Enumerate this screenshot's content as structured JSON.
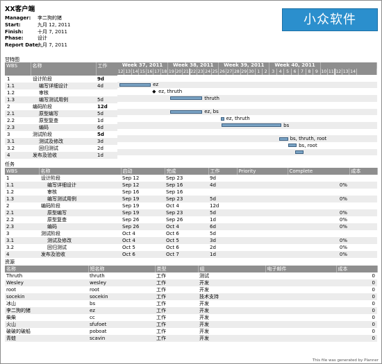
{
  "title": "XX客户端",
  "meta": [
    {
      "key": "Manager:",
      "value": "李二狗的猪"
    },
    {
      "key": "Start:",
      "value": "九月 12, 2011"
    },
    {
      "key": "Finish:",
      "value": "十月 7, 2011"
    },
    {
      "key": "Phase:",
      "value": "设计"
    },
    {
      "key": "Report Date:",
      "value": "九月 7, 2011"
    }
  ],
  "logo_text": "小众软件",
  "gantt": {
    "section_label": "甘特图",
    "headers": {
      "wbs": "WBS",
      "name": "名称",
      "work": "工作"
    },
    "weeks": [
      "Week 37, 2011",
      "Week 38, 2011",
      "Week 39, 2011",
      "Week 40, 2011"
    ],
    "days": [
      "12",
      "13",
      "14",
      "15",
      "16",
      "17",
      "18",
      "19",
      "20",
      "21",
      "22",
      "23",
      "24",
      "25",
      "26",
      "27",
      "28",
      "29",
      "30",
      "1",
      "2",
      "3",
      "4",
      "5",
      "6",
      "7",
      "8",
      "9",
      "10",
      "11",
      "12",
      "13",
      "14"
    ],
    "rows": [
      {
        "wbs": "1",
        "name": "设计阶段",
        "work": "9d",
        "bold": true,
        "label": ""
      },
      {
        "wbs": "1.1",
        "name": "编写详细设计",
        "work": "4d",
        "bold": false,
        "label": "ez"
      },
      {
        "wbs": "1.2",
        "name": "审核",
        "work": "",
        "bold": false,
        "label": "ez, thruth"
      },
      {
        "wbs": "1.3",
        "name": "编写测试用例",
        "work": "5d",
        "bold": false,
        "label": "thruth"
      },
      {
        "wbs": "2",
        "name": "编码阶段",
        "work": "12d",
        "bold": true,
        "label": ""
      },
      {
        "wbs": "2.1",
        "name": "原型编写",
        "work": "5d",
        "bold": false,
        "label": "ez, bs"
      },
      {
        "wbs": "2.2",
        "name": "原型复查",
        "work": "1d",
        "bold": false,
        "label": "ez, thruth"
      },
      {
        "wbs": "2.3",
        "name": "编码",
        "work": "6d",
        "bold": false,
        "label": "bs"
      },
      {
        "wbs": "3",
        "name": "测试阶段",
        "work": "5d",
        "bold": true,
        "label": ""
      },
      {
        "wbs": "3.1",
        "name": "测试及修改",
        "work": "3d",
        "bold": false,
        "label": "bs, thruth, root"
      },
      {
        "wbs": "3.2",
        "name": "回归测试",
        "work": "2d",
        "bold": false,
        "label": "bs, root"
      },
      {
        "wbs": "4",
        "name": "发布及验收",
        "work": "1d",
        "bold": false,
        "label": ""
      }
    ]
  },
  "tasks": {
    "section_label": "任务",
    "headers": [
      "WBS",
      "名称",
      "启动",
      "完成",
      "工作",
      "Priority",
      "Complete",
      "成本"
    ],
    "rows": [
      [
        "1",
        "设计阶段",
        "Sep 12",
        "Sep 23",
        "9d",
        "",
        "",
        ""
      ],
      [
        "1.1",
        "编写详细设计",
        "Sep 12",
        "Sep 16",
        "4d",
        "",
        "0%",
        ""
      ],
      [
        "1.2",
        "审核",
        "Sep 16",
        "Sep 16",
        "",
        "",
        "",
        ""
      ],
      [
        "1.3",
        "编写测试用例",
        "Sep 19",
        "Sep 23",
        "5d",
        "",
        "0%",
        ""
      ],
      [
        "2",
        "编码阶段",
        "Sep 19",
        "Oct 4",
        "12d",
        "",
        "",
        ""
      ],
      [
        "2.1",
        "原型编写",
        "Sep 19",
        "Sep 23",
        "5d",
        "",
        "0%",
        ""
      ],
      [
        "2.2",
        "原型复查",
        "Sep 26",
        "Sep 26",
        "1d",
        "",
        "0%",
        ""
      ],
      [
        "2.3",
        "编码",
        "Sep 26",
        "Oct 4",
        "6d",
        "",
        "0%",
        ""
      ],
      [
        "3",
        "测试阶段",
        "Oct 4",
        "Oct 6",
        "5d",
        "",
        "",
        ""
      ],
      [
        "3.1",
        "测试及修改",
        "Oct 4",
        "Oct 5",
        "3d",
        "",
        "0%",
        ""
      ],
      [
        "3.2",
        "回归测试",
        "Oct 5",
        "Oct 6",
        "2d",
        "",
        "0%",
        ""
      ],
      [
        "4",
        "发布及验收",
        "Oct 6",
        "Oct 7",
        "1d",
        "",
        "0%",
        ""
      ]
    ]
  },
  "resources": {
    "section_label": "资源",
    "headers": [
      "名称",
      "短名称",
      "类型",
      "组",
      "电子邮件",
      "成本"
    ],
    "rows": [
      [
        "Thruth",
        "thruth",
        "工作",
        "测试",
        "",
        "0"
      ],
      [
        "Wesley",
        "wesley",
        "工作",
        "开发",
        "",
        "0"
      ],
      [
        "root",
        "root",
        "工作",
        "开发",
        "",
        "0"
      ],
      [
        "socekin",
        "socekin",
        "工作",
        "技术支持",
        "",
        "0"
      ],
      [
        "冰山",
        "bs",
        "工作",
        "开发",
        "",
        "0"
      ],
      [
        "李二狗的猪",
        "ez",
        "工作",
        "开发",
        "",
        "0"
      ],
      [
        "柴柴",
        "cc",
        "工作",
        "开发",
        "",
        "0"
      ],
      [
        "火山",
        "sfufoet",
        "工作",
        "开发",
        "",
        "0"
      ],
      [
        "破破的破船",
        "poboat",
        "工作",
        "开发",
        "",
        "0"
      ],
      [
        "青蛙",
        "scavin",
        "工作",
        "开发",
        "",
        "0"
      ]
    ]
  },
  "footer": "This file was generated by Planner"
}
